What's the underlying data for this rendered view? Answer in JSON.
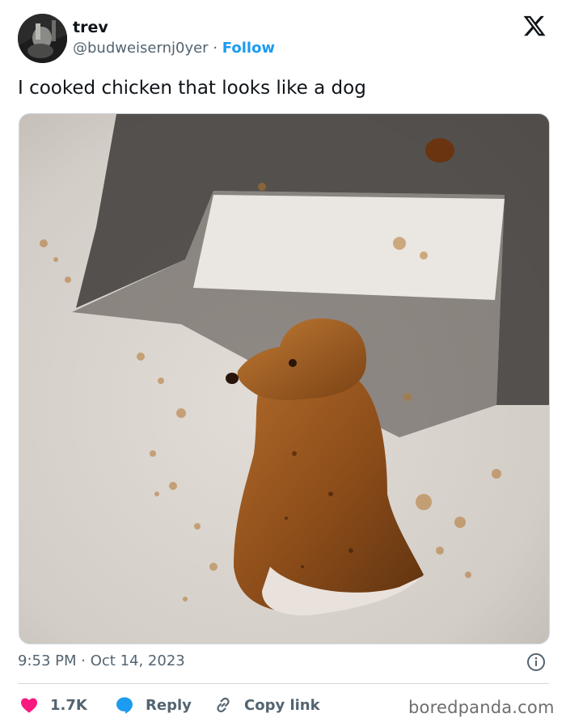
{
  "author": {
    "name": "trev",
    "handle": "@budweisernj0yer",
    "separator": "·",
    "follow_label": "Follow"
  },
  "platform_logo": "x-logo",
  "tweet": {
    "text": "I cooked chicken that looks like a dog",
    "time": "9:53 PM",
    "separator": "·",
    "date": "Oct 14, 2023"
  },
  "actions": {
    "like_count": "1.7K",
    "reply_label": "Reply",
    "copy_label": "Copy link"
  },
  "icons": {
    "like": "heart-icon",
    "reply": "speech-bubble-icon",
    "copy": "link-icon",
    "info": "info-icon"
  },
  "colors": {
    "like": "#f91880",
    "link": "#1d9bf0",
    "secondary_text": "#536471"
  },
  "watermark": "boredpanda.com"
}
